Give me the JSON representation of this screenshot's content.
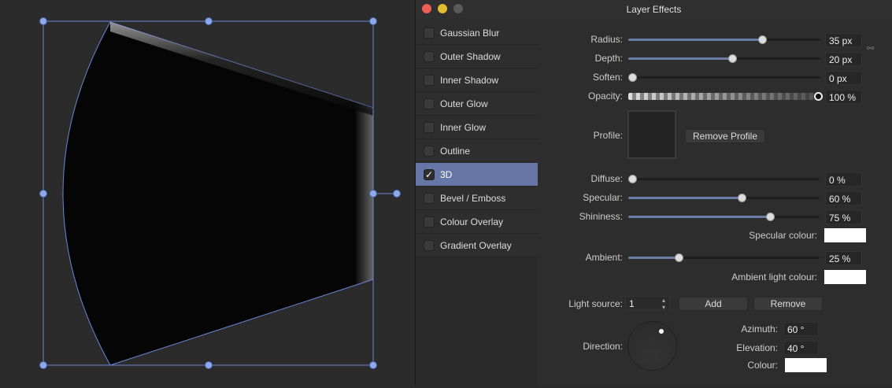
{
  "window": {
    "title": "Layer Effects"
  },
  "effects": [
    {
      "label": "Gaussian Blur",
      "checked": false
    },
    {
      "label": "Outer Shadow",
      "checked": false
    },
    {
      "label": "Inner Shadow",
      "checked": false
    },
    {
      "label": "Outer Glow",
      "checked": false
    },
    {
      "label": "Inner Glow",
      "checked": false
    },
    {
      "label": "Outline",
      "checked": false
    },
    {
      "label": "3D",
      "checked": true
    },
    {
      "label": "Bevel / Emboss",
      "checked": false
    },
    {
      "label": "Colour Overlay",
      "checked": false
    },
    {
      "label": "Gradient Overlay",
      "checked": false
    }
  ],
  "check_mark": "✓",
  "sliders": {
    "radius": {
      "label": "Radius:",
      "value": "35 px",
      "fraction": 0.7
    },
    "depth": {
      "label": "Depth:",
      "value": "20 px",
      "fraction": 0.54
    },
    "soften": {
      "label": "Soften:",
      "value": "0 px",
      "fraction": 0
    },
    "opacity": {
      "label": "Opacity:",
      "value": "100 %",
      "fraction": 1
    },
    "diffuse": {
      "label": "Diffuse:",
      "value": "0 %",
      "fraction": 0
    },
    "specular": {
      "label": "Specular:",
      "value": "60 %",
      "fraction": 0.59
    },
    "shininess": {
      "label": "Shininess:",
      "value": "75 %",
      "fraction": 0.74
    },
    "ambient": {
      "label": "Ambient:",
      "value": "25 %",
      "fraction": 0.25
    }
  },
  "profile": {
    "label": "Profile:",
    "remove_label": "Remove Profile"
  },
  "specular_colour": {
    "label": "Specular colour:",
    "color": "#ffffff"
  },
  "ambient_colour": {
    "label": "Ambient light colour:",
    "color": "#ffffff"
  },
  "light": {
    "label": "Light source:",
    "value": "1",
    "add": "Add",
    "remove": "Remove"
  },
  "direction": {
    "label": "Direction:",
    "azimuth_label": "Azimuth:",
    "azimuth": "60 °",
    "elevation_label": "Elevation:",
    "elevation": "40 °",
    "colour_label": "Colour:",
    "colour": "#ffffff"
  },
  "colors": {
    "accent": "#6676a6",
    "selection": "#6a86d8"
  }
}
